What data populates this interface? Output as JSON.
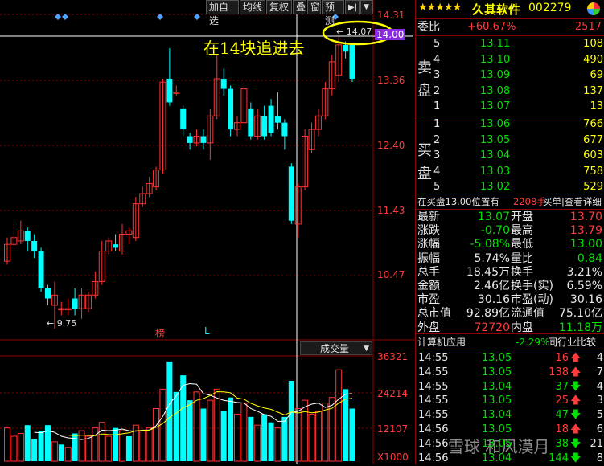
{
  "toolbar": {
    "buttons": [
      "加自选",
      "均线",
      "复权",
      "叠",
      "窗",
      "预测"
    ],
    "arrow_icon": "▶|",
    "dropdown_icon": "▼"
  },
  "chart": {
    "annotation": "在14块追进去",
    "price_ticks": [
      "14.31",
      "14.00",
      "13.36",
      "12.40",
      "11.43",
      "10.47"
    ],
    "volume_ticks": [
      "36321",
      "24214",
      "12107"
    ],
    "volume_unit": "X1000",
    "volume_label": "成交量",
    "high_mark": "14.07",
    "low_mark": "9.75",
    "mark_bang": "榜",
    "mark_l": "L",
    "colors": {
      "up": "#ff3333",
      "down": "#00ffff",
      "ma1": "#ffffff",
      "ma2": "#ffff00",
      "grid": "#8b0000",
      "highlight": "#ffff00",
      "price_box": "#8a2be2"
    }
  },
  "chart_data": {
    "type": "candlestick",
    "candles": [
      {
        "o": 10.75,
        "c": 11.0,
        "h": 11.1,
        "l": 10.7
      },
      {
        "o": 11.0,
        "c": 11.1,
        "h": 11.3,
        "l": 10.95
      },
      {
        "o": 11.05,
        "c": 11.2,
        "h": 11.35,
        "l": 11.0
      },
      {
        "o": 11.2,
        "c": 11.05,
        "h": 11.25,
        "l": 10.9
      },
      {
        "o": 11.05,
        "c": 10.9,
        "h": 11.15,
        "l": 10.8
      },
      {
        "o": 10.9,
        "c": 10.35,
        "h": 10.95,
        "l": 10.3
      },
      {
        "o": 10.35,
        "c": 10.2,
        "h": 10.4,
        "l": 10.1
      },
      {
        "o": 10.1,
        "c": 10.25,
        "h": 10.45,
        "l": 9.75
      },
      {
        "o": 10.05,
        "c": 10.05,
        "h": 10.15,
        "l": 9.95
      },
      {
        "o": 10.05,
        "c": 10.05,
        "h": 10.2,
        "l": 9.95
      },
      {
        "o": 10.2,
        "c": 10.05,
        "h": 10.35,
        "l": 9.95
      },
      {
        "o": 10.05,
        "c": 10.25,
        "h": 10.35,
        "l": 9.9
      },
      {
        "o": 10.05,
        "c": 10.25,
        "h": 10.3,
        "l": 10.0
      },
      {
        "o": 10.25,
        "c": 10.45,
        "h": 10.6,
        "l": 10.2
      },
      {
        "o": 10.45,
        "c": 10.9,
        "h": 11.05,
        "l": 10.4
      },
      {
        "o": 10.9,
        "c": 11.05,
        "h": 11.1,
        "l": 10.85
      },
      {
        "o": 11.0,
        "c": 10.95,
        "h": 11.15,
        "l": 10.9
      },
      {
        "o": 10.9,
        "c": 11.15,
        "h": 11.3,
        "l": 10.85
      },
      {
        "o": 11.15,
        "c": 11.2,
        "h": 11.25,
        "l": 11.0
      },
      {
        "o": 11.1,
        "c": 11.6,
        "h": 11.7,
        "l": 11.05
      },
      {
        "o": 11.6,
        "c": 11.75,
        "h": 11.85,
        "l": 11.55
      },
      {
        "o": 11.75,
        "c": 11.9,
        "h": 12.0,
        "l": 11.7
      },
      {
        "o": 11.85,
        "c": 12.1,
        "h": 12.15,
        "l": 11.8
      },
      {
        "o": 12.1,
        "c": 13.4,
        "h": 13.45,
        "l": 12.05
      },
      {
        "o": 13.45,
        "c": 13.1,
        "h": 13.9,
        "l": 13.05
      },
      {
        "o": 13.25,
        "c": 13.25,
        "h": 13.35,
        "l": 13.2
      },
      {
        "o": 13.0,
        "c": 12.7,
        "h": 13.05,
        "l": 12.6
      },
      {
        "o": 12.6,
        "c": 12.5,
        "h": 12.65,
        "l": 12.4
      },
      {
        "o": 12.5,
        "c": 12.6,
        "h": 12.7,
        "l": 12.45
      },
      {
        "o": 12.6,
        "c": 12.5,
        "h": 12.7,
        "l": 12.4
      },
      {
        "o": 12.5,
        "c": 12.9,
        "h": 13.0,
        "l": 12.25
      },
      {
        "o": 12.9,
        "c": 13.45,
        "h": 13.8,
        "l": 12.85
      },
      {
        "o": 13.45,
        "c": 13.3,
        "h": 13.6,
        "l": 13.2
      },
      {
        "o": 13.3,
        "c": 12.7,
        "h": 13.35,
        "l": 12.6
      },
      {
        "o": 12.7,
        "c": 12.8,
        "h": 12.9,
        "l": 12.6
      },
      {
        "o": 12.8,
        "c": 13.3,
        "h": 13.4,
        "l": 12.75
      },
      {
        "o": 13.0,
        "c": 12.6,
        "h": 13.1,
        "l": 12.55
      },
      {
        "o": 12.6,
        "c": 12.9,
        "h": 13.0,
        "l": 12.55
      },
      {
        "o": 12.9,
        "c": 12.6,
        "h": 13.05,
        "l": 12.55
      },
      {
        "o": 13.05,
        "c": 12.65,
        "h": 13.15,
        "l": 12.6
      },
      {
        "o": 12.9,
        "c": 12.8,
        "h": 13.25,
        "l": 12.7
      },
      {
        "o": 12.8,
        "c": 12.6,
        "h": 12.85,
        "l": 12.4
      },
      {
        "o": 12.15,
        "c": 11.35,
        "h": 12.2,
        "l": 11.3
      },
      {
        "o": 11.3,
        "c": 11.85,
        "h": 11.9,
        "l": 11.1
      },
      {
        "o": 11.85,
        "c": 12.6,
        "h": 12.7,
        "l": 11.8
      },
      {
        "o": 12.4,
        "c": 12.7,
        "h": 12.8,
        "l": 12.35
      },
      {
        "o": 12.7,
        "c": 12.9,
        "h": 13.0,
        "l": 12.6
      },
      {
        "o": 12.9,
        "c": 13.3,
        "h": 13.4,
        "l": 12.85
      },
      {
        "o": 13.3,
        "c": 13.7,
        "h": 13.8,
        "l": 13.2
      },
      {
        "o": 13.5,
        "c": 13.95,
        "h": 14.07,
        "l": 13.4
      },
      {
        "o": 13.95,
        "c": 13.85,
        "h": 14.0,
        "l": 13.75
      },
      {
        "o": 13.95,
        "c": 13.45,
        "h": 13.95,
        "l": 13.4
      }
    ],
    "volumes": [
      {
        "v": 12000,
        "up": true
      },
      {
        "v": 9000,
        "up": true
      },
      {
        "v": 10000,
        "up": true
      },
      {
        "v": 13000,
        "up": false
      },
      {
        "v": 8000,
        "up": false
      },
      {
        "v": 11000,
        "up": false
      },
      {
        "v": 13000,
        "up": false
      },
      {
        "v": 7000,
        "up": true
      },
      {
        "v": 6000,
        "up": false
      },
      {
        "v": 5000,
        "up": true
      },
      {
        "v": 10000,
        "up": false
      },
      {
        "v": 11000,
        "up": true
      },
      {
        "v": 9000,
        "up": true
      },
      {
        "v": 12000,
        "up": true
      },
      {
        "v": 14000,
        "up": true
      },
      {
        "v": 9000,
        "up": true
      },
      {
        "v": 12000,
        "up": false
      },
      {
        "v": 11000,
        "up": true
      },
      {
        "v": 9000,
        "up": false
      },
      {
        "v": 13000,
        "up": true
      },
      {
        "v": 11000,
        "up": true
      },
      {
        "v": 12000,
        "up": true
      },
      {
        "v": 19000,
        "up": true
      },
      {
        "v": 26000,
        "up": true
      },
      {
        "v": 36000,
        "up": false
      },
      {
        "v": 25000,
        "up": false
      },
      {
        "v": 31000,
        "up": false
      },
      {
        "v": 22000,
        "up": false
      },
      {
        "v": 25000,
        "up": true
      },
      {
        "v": 19000,
        "up": false
      },
      {
        "v": 22000,
        "up": true
      },
      {
        "v": 26000,
        "up": true
      },
      {
        "v": 18000,
        "up": false
      },
      {
        "v": 23000,
        "up": false
      },
      {
        "v": 17000,
        "up": true
      },
      {
        "v": 21000,
        "up": true
      },
      {
        "v": 16000,
        "up": false
      },
      {
        "v": 13000,
        "up": true
      },
      {
        "v": 17000,
        "up": false
      },
      {
        "v": 14000,
        "up": false
      },
      {
        "v": 12000,
        "up": true
      },
      {
        "v": 16000,
        "up": false
      },
      {
        "v": 29000,
        "up": false
      },
      {
        "v": 19000,
        "up": true
      },
      {
        "v": 22000,
        "up": true
      },
      {
        "v": 17000,
        "up": true
      },
      {
        "v": 18000,
        "up": true
      },
      {
        "v": 21000,
        "up": true
      },
      {
        "v": 23000,
        "up": true
      },
      {
        "v": 33000,
        "up": true
      },
      {
        "v": 26000,
        "up": false
      },
      {
        "v": 19000,
        "up": false
      }
    ],
    "ylim": [
      9.6,
      14.4
    ],
    "vol_max": 38000
  },
  "panel": {
    "stars": "★★★★★",
    "name": "久其软件",
    "code": "002279",
    "weibi_label": "委比",
    "weibi_value": "+60.67%",
    "weibi_count": "2517",
    "sell_label": [
      "卖",
      "盘"
    ],
    "buy_label": [
      "买",
      "盘"
    ],
    "sell": [
      {
        "n": "5",
        "p": "13.11",
        "q": "108"
      },
      {
        "n": "4",
        "p": "13.10",
        "q": "490"
      },
      {
        "n": "3",
        "p": "13.09",
        "q": "69"
      },
      {
        "n": "2",
        "p": "13.08",
        "q": "137"
      },
      {
        "n": "1",
        "p": "13.07",
        "q": "13"
      }
    ],
    "buy": [
      {
        "n": "1",
        "p": "13.06",
        "q": "766"
      },
      {
        "n": "2",
        "p": "13.05",
        "q": "677"
      },
      {
        "n": "3",
        "p": "13.04",
        "q": "603"
      },
      {
        "n": "4",
        "p": "13.03",
        "q": "758"
      },
      {
        "n": "5",
        "p": "13.02",
        "q": "529"
      }
    ],
    "info_left": "在买盘13.00位置有",
    "info_qty": "2208手",
    "info_right": "买单|查看详细",
    "stats": [
      {
        "l1": "最新",
        "v1": "13.07",
        "c1": "green",
        "l2": "开盘",
        "v2": "13.70",
        "c2": "red"
      },
      {
        "l1": "涨跌",
        "v1": "-0.70",
        "c1": "green",
        "l2": "最高",
        "v2": "13.79",
        "c2": "red"
      },
      {
        "l1": "涨幅",
        "v1": "-5.08%",
        "c1": "green",
        "l2": "最低",
        "v2": "13.00",
        "c2": "green"
      },
      {
        "l1": "振幅",
        "v1": "5.74%",
        "c1": "white",
        "l2": "量比",
        "v2": "0.84",
        "c2": "green"
      },
      {
        "l1": "总手",
        "v1": "18.45万",
        "c1": "white",
        "l2": "换手",
        "v2": "3.21%",
        "c2": "white"
      },
      {
        "l1": "金额",
        "v1": "2.46亿",
        "c1": "white",
        "l2": "换手(实)",
        "v2": "6.59%",
        "c2": "white"
      },
      {
        "l1": "市盈",
        "v1": "30.16",
        "c1": "white",
        "l2": "市盈(动)",
        "v2": "30.16",
        "c2": "white"
      },
      {
        "l1": "总市值",
        "v1": "92.89亿",
        "c1": "white",
        "l2": "流通值",
        "v2": "75.10亿",
        "c2": "white"
      },
      {
        "l1": "外盘",
        "v1": "72720",
        "c1": "red",
        "l2": "内盘",
        "v2": "11.18万",
        "c2": "green"
      }
    ],
    "sector_label": "计算机应用",
    "sector_change": "-2.29%",
    "sector_compare": "同行业比较",
    "ticks": [
      {
        "t": "14:55",
        "p": "13.05",
        "q": "16",
        "d": "up",
        "n": "4"
      },
      {
        "t": "14:55",
        "p": "13.05",
        "q": "138",
        "d": "up",
        "n": "7"
      },
      {
        "t": "14:55",
        "p": "13.04",
        "q": "37",
        "d": "down",
        "n": "4"
      },
      {
        "t": "14:55",
        "p": "13.05",
        "q": "25",
        "d": "up",
        "n": "3"
      },
      {
        "t": "14:55",
        "p": "13.04",
        "q": "47",
        "d": "down",
        "n": "5"
      },
      {
        "t": "14:56",
        "p": "13.05",
        "q": "18",
        "d": "up",
        "n": "6"
      },
      {
        "t": "14:56",
        "p": "13.05",
        "q": "38",
        "d": "down",
        "n": "21"
      },
      {
        "t": "14:56",
        "p": "13.04",
        "q": "144",
        "d": "down",
        "n": "8"
      }
    ],
    "watermark": "雪球  和风漠月"
  }
}
